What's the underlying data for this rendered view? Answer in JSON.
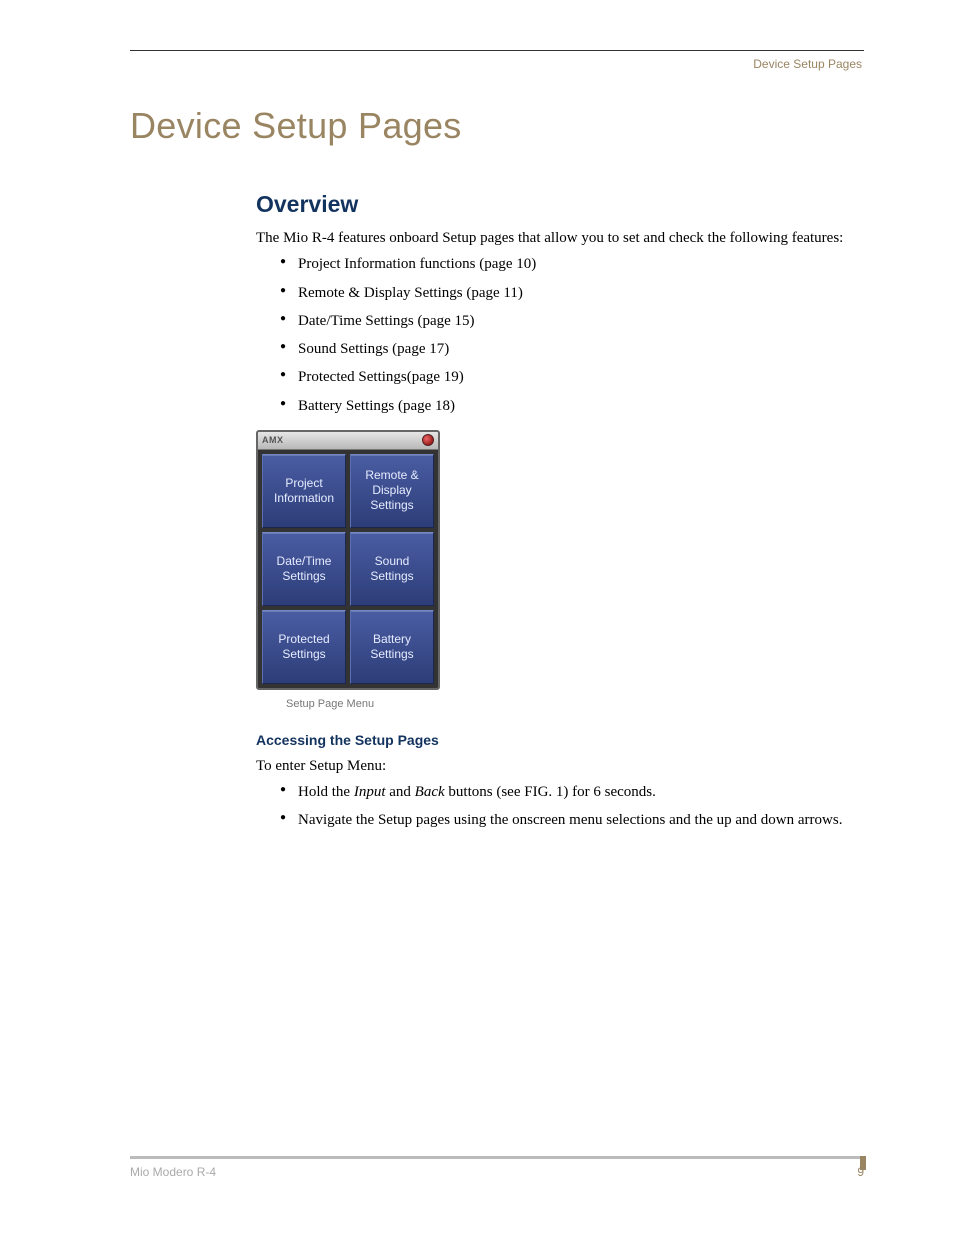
{
  "running_head": "Device Setup Pages",
  "chapter_title": "Device Setup Pages",
  "overview": {
    "heading": "Overview",
    "intro": "The Mio R-4 features onboard Setup pages that allow you to set and check the following features:",
    "bullets": [
      "Project Information functions (page 10)",
      "Remote & Display Settings (page 11)",
      "Date/Time Settings (page 15)",
      "Sound Settings (page 17)",
      "Protected Settings(page 19)",
      "Battery Settings (page 18)"
    ]
  },
  "figure": {
    "logo": "AMX",
    "buttons": [
      "Project\nInformation",
      "Remote &\nDisplay\nSettings",
      "Date/Time\nSettings",
      "Sound\nSettings",
      "Protected\nSettings",
      "Battery\nSettings"
    ],
    "caption": "Setup Page Menu"
  },
  "accessing": {
    "heading": "Accessing the Setup Pages",
    "intro": "To enter Setup Menu:",
    "step1_pre": "Hold the ",
    "step1_i1": "Input",
    "step1_mid": " and ",
    "step1_i2": "Back",
    "step1_post": " buttons (see FIG. 1) for 6 seconds.",
    "step2": "Navigate the Setup pages using the onscreen menu selections and the up and down arrows."
  },
  "footer": {
    "left": "Mio Modero R-4",
    "right": "9"
  }
}
